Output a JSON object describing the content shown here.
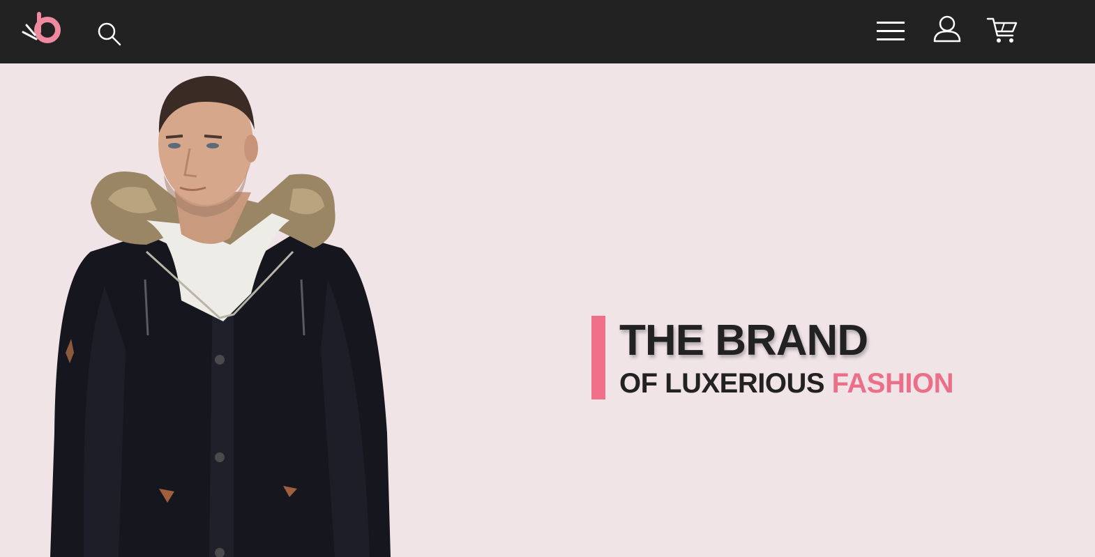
{
  "header": {
    "logo_icon": "brand-logo-icon",
    "search_icon": "search-icon",
    "menu_icon": "hamburger-menu-icon",
    "account_icon": "user-account-icon",
    "cart_icon": "shopping-cart-icon"
  },
  "hero": {
    "image": "model-in-black-parka-with-fur-hood",
    "headline_line1": "THE BRAND",
    "headline_line2_prefix": "OF LUXERIOUS",
    "headline_line2_highlight": "FASHION"
  },
  "colors": {
    "header_bg": "#222222",
    "hero_bg": "#f0e4e7",
    "accent": "#f0708a",
    "text_dark": "#222222"
  }
}
